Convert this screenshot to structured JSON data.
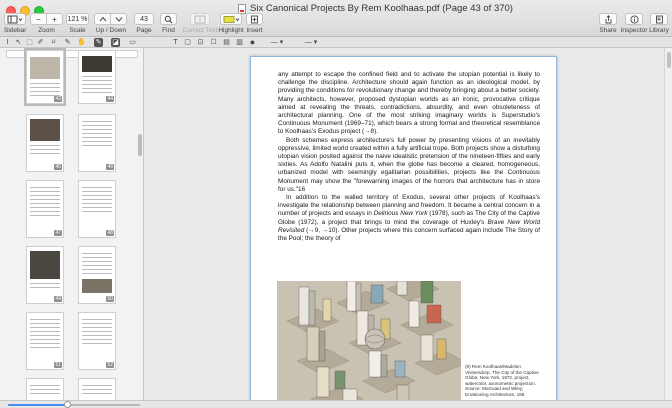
{
  "window": {
    "title": "Six Canonical Projects By Rem Koolhaas.pdf (Page 43 of 370)"
  },
  "toolbar": {
    "sidebar_label": "Sidebar",
    "zoom_label": "Zoom",
    "zoom_out": "−",
    "zoom_in": "+",
    "scale_label": "Scale",
    "scale_value": "121 %",
    "updown_label": "Up / Down",
    "page_label": "Page",
    "page_value": "43",
    "find_label": "Find",
    "correct_text_label": "Correct Text",
    "highlight_label": "Highlight",
    "insert_label": "Insert",
    "share_label": "Share",
    "inspector_label": "Inspector",
    "library_label": "Library"
  },
  "sidebar": {
    "thumbnails": [
      {
        "page": "43"
      },
      {
        "page": "44"
      },
      {
        "page": "45"
      },
      {
        "page": "46"
      },
      {
        "page": "47"
      },
      {
        "page": "48"
      },
      {
        "page": "49"
      },
      {
        "page": "50"
      },
      {
        "page": "51"
      },
      {
        "page": "52"
      }
    ],
    "zoom_fraction": 0.45
  },
  "document": {
    "para1": "any attempt to escape the confined field and to activate the utopian potential is likely to challenge the discipline. Architecture should again function as an ideological model, by providing the conditions for revolutionary change and thereby bringing about a better society. Many architects, however, proposed dystopian worlds as an ironic, provocative critique aimed at revealing the threats, contradictions, absurdity, and even obsoleteness of architectural planning. One of the most striking imaginary worlds is Superstudio's Continuous Monument (1969–71), which bears a strong formal and theoretical resemblance to Koolhaas's Exodus project (→8).",
    "para2": "Both schemes express architecture's full power by presenting visions of an inevitably oppressive, limited world created within a fully artificial trope. Both projects show a disturbing utopian vision posited against the naive idealistic pretension of the nineteen-fifties and early sixties. As Adolfo Natalini puts it, when the globe has become a cleared, homogeneous, urbanized model with seemingly egalitarian possibilities, projects like the Continuous Monument may show the \"forewarning images of the horrors that architecture has in store for us.\"16",
    "para3_a": "In addition to the walled territory of Exodus, several other projects of Koolhaas's investigate the relationship between planning and freedom. It became a central concern in a number of projects and essays in ",
    "para3_i1": "Delirious New York",
    "para3_b": " (1978), such as The City of the Captive Globe (1972), a project that brings to mind the coverage of Huxley's ",
    "para3_i2": "Brave New World Revisited",
    "para3_c": " (→9, →10). Other projects where this concern surfaced again include The Story of the Pool; the theory of",
    "caption": "(9) Rem Koolhaas/Madelon Vriesendorp, The City of the Captive Globe, New York, 1972, project, watercolor, axonometric projection. Source: MoGuaid and Wiley, Envisioning Architecture, 188"
  }
}
